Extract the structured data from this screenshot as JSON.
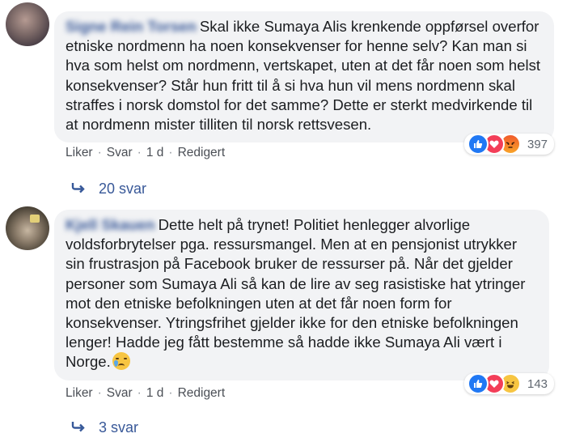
{
  "comments": [
    {
      "author": "Signe Rein Torsen",
      "text": "Skal ikke Sumaya Alis krenkende oppførsel overfor etniske nordmenn ha noen konsekvenser for henne selv? Kan man si hva som helst om nordmenn, vertskapet, uten at det får noen som helst konsekvenser? Står hun fritt til å si hva hun vil mens nordmenn skal straffes i norsk domstol for det samme? Dette er sterkt medvirkende til at nordmenn mister tilliten til norsk rettsvesen.",
      "like_label": "Liker",
      "reply_label": "Svar",
      "time": "1 d",
      "edited_label": "Redigert",
      "reaction_count": "397",
      "replies_label": "20 svar"
    },
    {
      "author": "Kjell Skauen",
      "text": "Dette helt på trynet! Politiet henlegger alvorlige voldsforbrytelser pga. ressursmangel. Men at en pensjonist utrykker sin frustrasjon på Facebook bruker de ressurser på. Når det gjelder personer som Sumaya Ali så kan de lire av seg rasistiske hat ytringer mot den etniske befolkningen uten at det får noen form for konsekvenser. Ytringsfrihet gjelder ikke for den etniske befolkningen lenger! Hadde jeg fått bestemme så hadde ikke Sumaya Ali vært i Norge.",
      "like_label": "Liker",
      "reply_label": "Svar",
      "time": "1 d",
      "edited_label": "Redigert",
      "reaction_count": "143",
      "replies_label": "3 svar"
    }
  ],
  "icons": {
    "reactions_1": [
      "like-icon",
      "love-icon",
      "angry-icon"
    ],
    "reactions_2": [
      "like-icon",
      "love-icon",
      "haha-icon"
    ],
    "reply_arrow": "reply-arrow-icon",
    "inline_emoji": "crying-face-emoji"
  },
  "colors": {
    "bubble": "#f2f3f5",
    "link": "#385898",
    "meta": "#606770",
    "like": "#2078f4",
    "love": "#f33e58"
  }
}
